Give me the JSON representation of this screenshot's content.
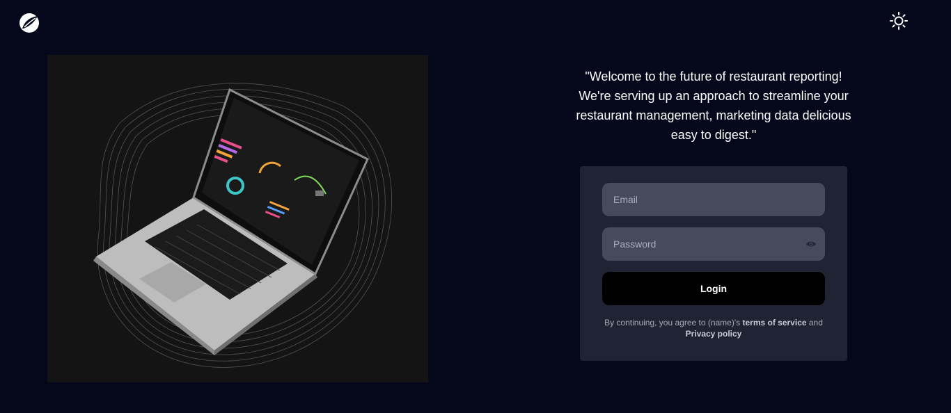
{
  "logo": {
    "icon": "leaf-logo-icon"
  },
  "header": {
    "theme_toggle_icon": "sun-icon"
  },
  "hero": {
    "image": "laptop-dashboard-illustration"
  },
  "quote": {
    "text": "\"Welcome to the future of restaurant reporting! We're serving up an approach to streamline your restaurant management, marketing data delicious easy to digest.\""
  },
  "login_form": {
    "email_placeholder": "Email",
    "email_value": "",
    "password_placeholder": "Password",
    "password_value": "",
    "password_toggle_icon": "eye-icon",
    "login_label": "Login",
    "terms_prefix": "By continuing, you agree to (name)'s ",
    "terms_link": "terms of service",
    "terms_and": " and",
    "privacy_link": "Privacy policy"
  },
  "colors": {
    "background": "#05071a",
    "card": "#1f2333",
    "input": "#454a5c",
    "button": "#000000",
    "hero_bg": "#141414"
  }
}
